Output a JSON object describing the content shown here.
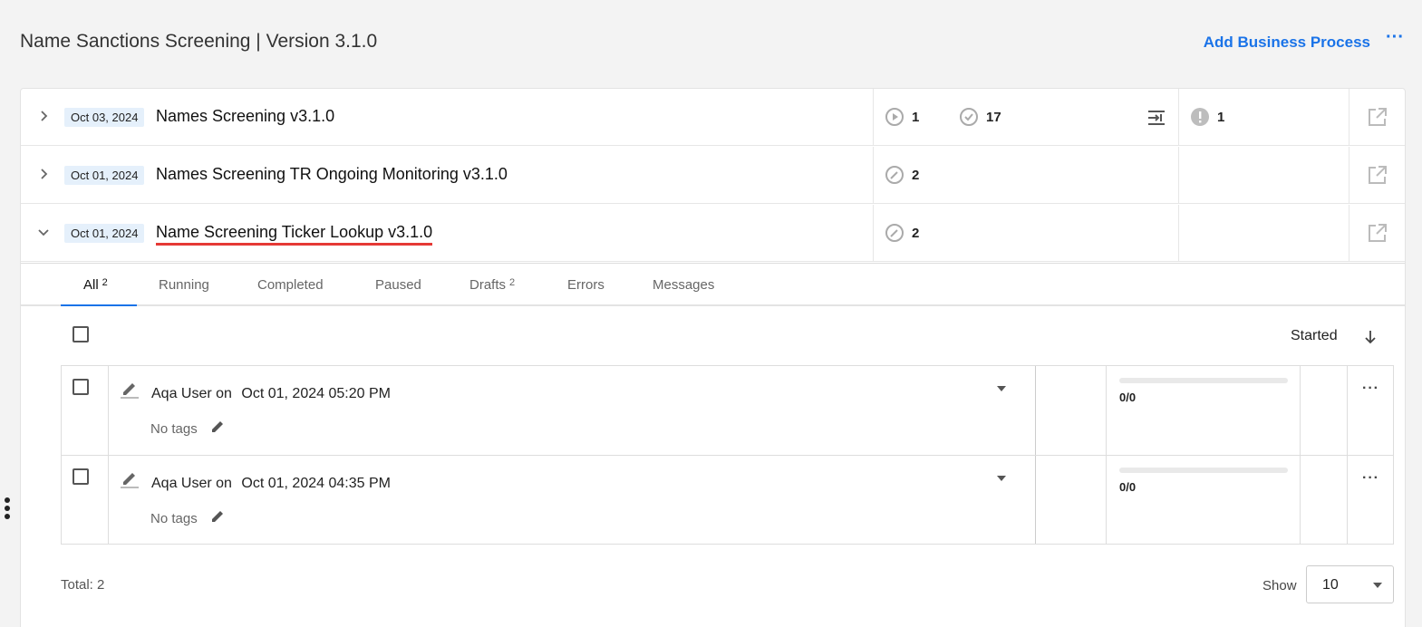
{
  "header": {
    "title": "Name Sanctions Screening | Version 3.1.0",
    "add_business_process": "Add Business Process",
    "more": "···"
  },
  "processes": [
    {
      "date": "Oct 03, 2024",
      "name": "Names Screening v3.1.0",
      "expanded": false,
      "running_count": "1",
      "completed_count": "17",
      "error_count": "1"
    },
    {
      "date": "Oct 01, 2024",
      "name": "Names Screening TR Ongoing Monitoring v3.1.0",
      "expanded": false,
      "draft_count": "2"
    },
    {
      "date": "Oct 01, 2024",
      "name": "Name Screening Ticker Lookup v3.1.0",
      "expanded": true,
      "draft_count": "2"
    }
  ],
  "tabs": [
    {
      "label": "All",
      "count": "2",
      "active": true
    },
    {
      "label": "Running",
      "count": ""
    },
    {
      "label": "Completed",
      "count": ""
    },
    {
      "label": "Paused",
      "count": ""
    },
    {
      "label": "Drafts",
      "count": "2"
    },
    {
      "label": "Errors",
      "count": ""
    },
    {
      "label": "Messages",
      "count": ""
    }
  ],
  "list": {
    "sort_label": "Started",
    "items": [
      {
        "author": "Aqa User",
        "on": "on",
        "timestamp": "Oct 01, 2024 05:20 PM",
        "tags": "No tags",
        "progress_text": "0/0",
        "progress_fraction": 0,
        "more": "···"
      },
      {
        "author": "Aqa User",
        "on": "on",
        "timestamp": "Oct 01, 2024 04:35 PM",
        "tags": "No tags",
        "progress_text": "0/0",
        "progress_fraction": 0,
        "more": "···"
      }
    ]
  },
  "footer": {
    "total": "Total: 2",
    "show_label": "Show",
    "page_size": "10"
  },
  "colors": {
    "accent": "#1a73e8",
    "date_badge_bg": "#e5f0fb",
    "highlight_underline": "#e53935"
  }
}
